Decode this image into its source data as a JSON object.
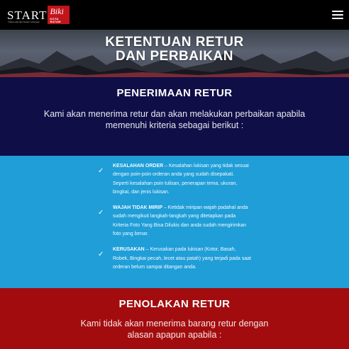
{
  "header": {
    "logo": {
      "word": "START",
      "box_text": "Biki",
      "box_sub": "KOTA BATAM",
      "tagline": "Tulisan asli dan Desain indonesia"
    },
    "menu_icon": "hamburger-icon"
  },
  "hero": {
    "title_line1": "KETENTUAN RETUR",
    "title_line2": "DAN PERBAIKAN"
  },
  "acceptance": {
    "heading": "PENERIMAAN RETUR",
    "intro": "Kami akan menerima retur dan akan melakukan perbaikan apabila memenuhi kriteria sebagai berikut :",
    "criteria": [
      {
        "title": "KESALAHAN ORDER",
        "text": " – Kesalahan lukisan yang tidak sesuai dengan poin-poin orderan anda yang sudah disepakati. Seperti kesalahan poin tulisan, penerapan tema, ukuran, bingkai, dan jenis lukisan."
      },
      {
        "title": "WAJAH TIDAK MIRIP",
        "text": " – Ketidak miripan wajah padahal anda sudah mengikuti langkah-langkah yang ditetapkan pada Kriteria Foto Yang Bisa Dilukis dan anda sudah mengirimkan foto yang benar."
      },
      {
        "title": "KERUSAKAN",
        "text": " – Kerusakan pada lukisan (Kotor, Basah, Robek, Bingkai pecah, lecet atau patah) yang terjadi pada saat orderan belum sampai ditangan anda."
      }
    ]
  },
  "rejection": {
    "heading": "PENOLAKAN RETUR",
    "intro": "Kami tidak akan menerima barang retur dengan alasan apapun apabila :"
  },
  "colors": {
    "navy": "#0f0e47",
    "blue": "#1f9ed8",
    "red": "#a30c0e",
    "logo_red": "#c0151b"
  }
}
